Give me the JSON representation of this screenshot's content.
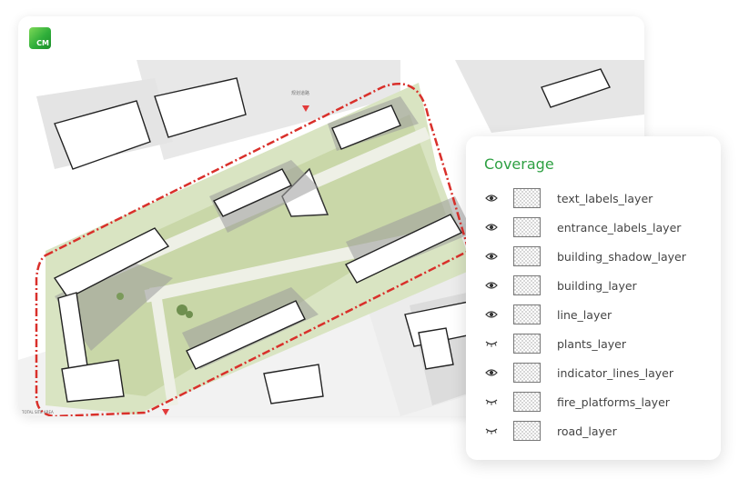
{
  "app": {
    "logo_text": "CM"
  },
  "map": {
    "road_label": "规划道路",
    "footnote": "TOTAL SITE AREA"
  },
  "panel": {
    "title": "Coverage",
    "layers": [
      {
        "name": "text_labels_layer",
        "visible": true,
        "icon": "eye-open-icon"
      },
      {
        "name": "entrance_labels_layer",
        "visible": true,
        "icon": "eye-open-icon"
      },
      {
        "name": "building_shadow_layer",
        "visible": true,
        "icon": "eye-open-icon"
      },
      {
        "name": "building_layer",
        "visible": true,
        "icon": "eye-open-icon"
      },
      {
        "name": "line_layer",
        "visible": true,
        "icon": "eye-open-icon"
      },
      {
        "name": "plants_layer",
        "visible": false,
        "icon": "eye-closed-icon"
      },
      {
        "name": "indicator_lines_layer",
        "visible": true,
        "icon": "eye-open-icon"
      },
      {
        "name": "fire_platforms_layer",
        "visible": false,
        "icon": "eye-closed-icon"
      },
      {
        "name": "road_layer",
        "visible": false,
        "icon": "eye-closed-icon"
      }
    ]
  },
  "colors": {
    "accent": "#2ea043",
    "boundary": "#d9302b",
    "green_space": "#cfdcb0"
  }
}
